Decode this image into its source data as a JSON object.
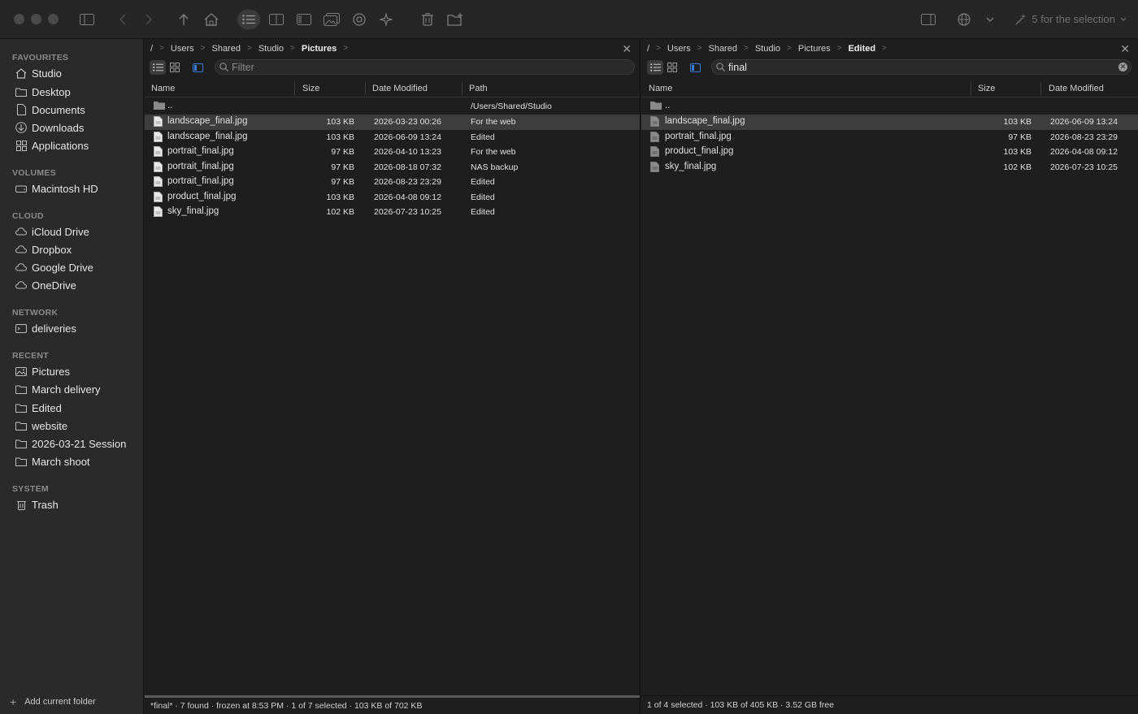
{
  "toolbar": {
    "selection_label": "5 for the selection"
  },
  "sidebar": {
    "sections": [
      {
        "heading": "FAVOURITES",
        "items": [
          {
            "label": "Studio",
            "icon": "home-icon"
          },
          {
            "label": "Desktop",
            "icon": "folder-icon"
          },
          {
            "label": "Documents",
            "icon": "document-icon"
          },
          {
            "label": "Downloads",
            "icon": "download-icon"
          },
          {
            "label": "Applications",
            "icon": "apps-icon"
          }
        ]
      },
      {
        "heading": "VOLUMES",
        "items": [
          {
            "label": "Macintosh HD",
            "icon": "drive-icon"
          }
        ]
      },
      {
        "heading": "CLOUD",
        "items": [
          {
            "label": "iCloud Drive",
            "icon": "cloud-icon"
          },
          {
            "label": "Dropbox",
            "icon": "cloud-icon"
          },
          {
            "label": "Google Drive",
            "icon": "cloud-icon"
          },
          {
            "label": "OneDrive",
            "icon": "cloud-icon"
          }
        ]
      },
      {
        "heading": "NETWORK",
        "items": [
          {
            "label": "deliveries",
            "icon": "network-drive-icon"
          }
        ]
      },
      {
        "heading": "RECENT",
        "items": [
          {
            "label": "Pictures",
            "icon": "pictures-icon"
          },
          {
            "label": "March delivery",
            "icon": "folder-icon"
          },
          {
            "label": "Edited",
            "icon": "folder-icon"
          },
          {
            "label": "website",
            "icon": "folder-icon"
          },
          {
            "label": "2026-03-21 Session",
            "icon": "folder-icon"
          },
          {
            "label": "March shoot",
            "icon": "folder-icon"
          }
        ]
      },
      {
        "heading": "SYSTEM",
        "items": [
          {
            "label": "Trash",
            "icon": "trash-icon"
          }
        ]
      }
    ],
    "footer_label": "Add current folder"
  },
  "left_pane": {
    "breadcrumb": [
      "/",
      "Users",
      "Shared",
      "Studio",
      "Pictures"
    ],
    "filter_placeholder": "Filter",
    "filter_value": "",
    "columns": {
      "name": "Name",
      "size": "Size",
      "date": "Date Modified",
      "path": "Path"
    },
    "parent_row": {
      "name": "..",
      "path": "/Users/Shared/Studio"
    },
    "rows": [
      {
        "name": "landscape_final.jpg",
        "size": "103 KB",
        "date": "2026-03-23 00:26",
        "path": "For the web",
        "selected": true
      },
      {
        "name": "landscape_final.jpg",
        "size": "103 KB",
        "date": "2026-06-09 13:24",
        "path": "Edited",
        "selected": false
      },
      {
        "name": "portrait_final.jpg",
        "size": "97 KB",
        "date": "2026-04-10 13:23",
        "path": "For the web",
        "selected": false
      },
      {
        "name": "portrait_final.jpg",
        "size": "97 KB",
        "date": "2026-08-18 07:32",
        "path": "NAS backup",
        "selected": false
      },
      {
        "name": "portrait_final.jpg",
        "size": "97 KB",
        "date": "2026-08-23 23:29",
        "path": "Edited",
        "selected": false
      },
      {
        "name": "product_final.jpg",
        "size": "103 KB",
        "date": "2026-04-08 09:12",
        "path": "Edited",
        "selected": false
      },
      {
        "name": "sky_final.jpg",
        "size": "102 KB",
        "date": "2026-07-23 10:25",
        "path": "Edited",
        "selected": false
      }
    ],
    "status": "*final*  ·  7 found  ·  frozen at 8:53 PM  ·  1 of 7 selected · 103 KB of 702 KB"
  },
  "right_pane": {
    "breadcrumb": [
      "/",
      "Users",
      "Shared",
      "Studio",
      "Pictures",
      "Edited"
    ],
    "filter_value": "final",
    "columns": {
      "name": "Name",
      "size": "Size",
      "date": "Date Modified"
    },
    "parent_row": {
      "name": ".."
    },
    "rows": [
      {
        "name": "landscape_final.jpg",
        "size": "103 KB",
        "date": "2026-06-09 13:24",
        "selected": true
      },
      {
        "name": "portrait_final.jpg",
        "size": "97 KB",
        "date": "2026-08-23 23:29",
        "selected": false
      },
      {
        "name": "product_final.jpg",
        "size": "103 KB",
        "date": "2026-04-08 09:12",
        "selected": false
      },
      {
        "name": "sky_final.jpg",
        "size": "102 KB",
        "date": "2026-07-23 10:25",
        "selected": false
      }
    ],
    "status": "1 of 4 selected · 103 KB of 405 KB · 3.52 GB free"
  }
}
